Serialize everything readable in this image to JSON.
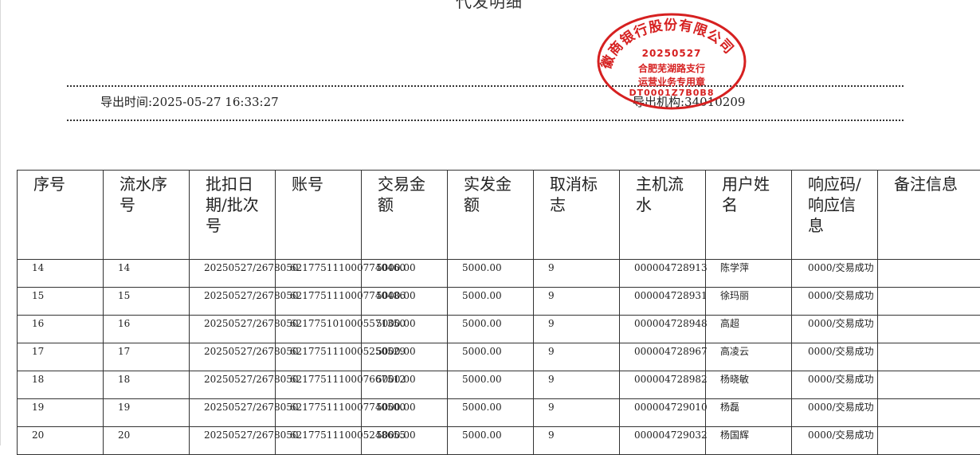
{
  "document": {
    "title": "代发明细",
    "export_time": "导出时间:2025-05-27  16:33:27",
    "export_org": "导出机构:34010209"
  },
  "stamp": {
    "arc_text": "徽商银行股份有限公司",
    "date": "20250527",
    "branch": "合肥芜湖路支行",
    "purpose": "运营业务专用章",
    "code": "DT0001Z7B0B8",
    "color": "#d62020"
  },
  "table": {
    "headers": [
      "序号",
      "流水序号",
      "批扣日期/批次号",
      "账号",
      "交易金额",
      "实发金额",
      "取消标志",
      "主机流水",
      "用户姓名",
      "响应码/响应信息",
      "备注信息"
    ],
    "rows": [
      {
        "seq": "14",
        "serial": "14",
        "batch": "20250527/2678050",
        "account": "6217751110007740460",
        "amount": "5000.00",
        "paid": "5000.00",
        "cancel": "9",
        "host": "000004728913",
        "name": "陈学萍",
        "resp": "0000/交易成功",
        "note": ""
      },
      {
        "seq": "15",
        "serial": "15",
        "batch": "20250527/2678050",
        "account": "6217751110007740486",
        "amount": "5000.00",
        "paid": "5000.00",
        "cancel": "9",
        "host": "000004728931",
        "name": "徐玛丽",
        "resp": "0000/交易成功",
        "note": ""
      },
      {
        "seq": "16",
        "serial": "16",
        "batch": "20250527/2678050",
        "account": "6217751010005571350",
        "amount": "5000.00",
        "paid": "5000.00",
        "cancel": "9",
        "host": "000004728948",
        "name": "高超",
        "resp": "0000/交易成功",
        "note": ""
      },
      {
        "seq": "17",
        "serial": "17",
        "batch": "20250527/2678050",
        "account": "6217751110005250529",
        "amount": "5000.00",
        "paid": "5000.00",
        "cancel": "9",
        "host": "000004728967",
        "name": "高凌云",
        "resp": "0000/交易成功",
        "note": ""
      },
      {
        "seq": "18",
        "serial": "18",
        "batch": "20250527/2678050",
        "account": "6217751110007667512",
        "amount": "5000.00",
        "paid": "5000.00",
        "cancel": "9",
        "host": "000004728982",
        "name": "杨晓敏",
        "resp": "0000/交易成功",
        "note": ""
      },
      {
        "seq": "19",
        "serial": "19",
        "batch": "20250527/2678050",
        "account": "6217751110007740500",
        "amount": "5000.00",
        "paid": "5000.00",
        "cancel": "9",
        "host": "000004729010",
        "name": "杨磊",
        "resp": "0000/交易成功",
        "note": ""
      },
      {
        "seq": "20",
        "serial": "20",
        "batch": "20250527/2678050",
        "account": "6217751110005248655",
        "amount": "5000.00",
        "paid": "5000.00",
        "cancel": "9",
        "host": "000004729032",
        "name": "杨国辉",
        "resp": "0000/交易成功",
        "note": ""
      }
    ]
  }
}
